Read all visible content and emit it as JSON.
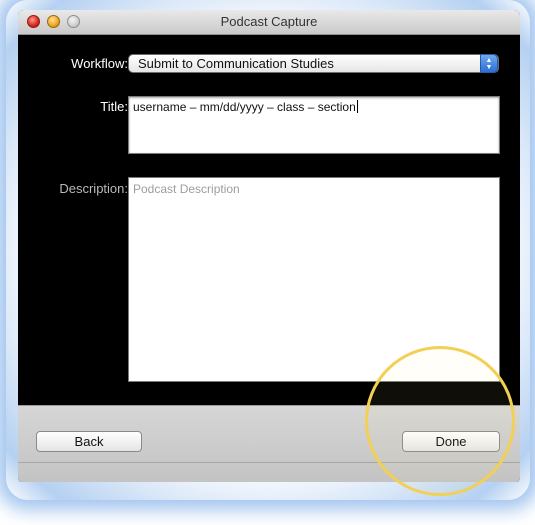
{
  "window": {
    "title": "Podcast Capture"
  },
  "form": {
    "workflow_label": "Workflow:",
    "workflow_value": "Submit to Communication Studies",
    "title_label": "Title:",
    "title_value": "username – mm/dd/yyyy – class – section",
    "description_label": "Description:",
    "description_placeholder": "Podcast Description"
  },
  "buttons": {
    "back_label": "Back",
    "done_label": "Done"
  },
  "colors": {
    "highlight": "#f2cf55",
    "glow": "#6ea5e6",
    "popup_accent": "#2a6fd6"
  },
  "icons": {
    "close": "close-icon",
    "minimize": "minimize-icon",
    "zoom": "zoom-icon",
    "popup_arrows": "updown-arrows-icon"
  }
}
